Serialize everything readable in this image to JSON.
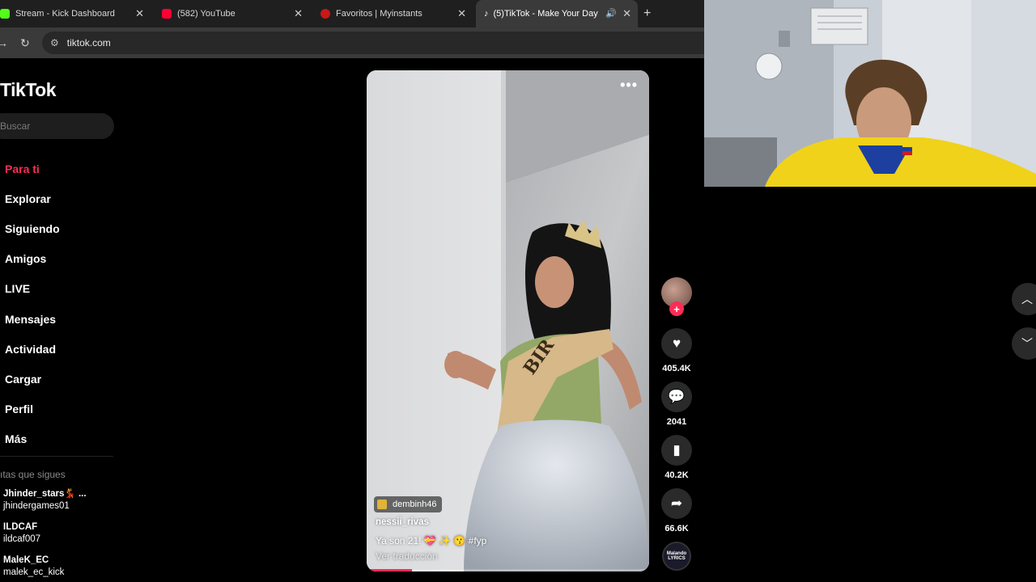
{
  "browser": {
    "tabs": [
      {
        "title": "Stream - Kick Dashboard",
        "favicon_color": "#53fc18"
      },
      {
        "title": "(582) YouTube",
        "favicon_color": "#ff0033"
      },
      {
        "title": "Favoritos | Myinstants",
        "favicon_color": "#c81818"
      },
      {
        "title": "(5)TikTok - Make Your Day",
        "favicon_color": "#000000"
      }
    ],
    "new_tab_glyph": "+",
    "url": "tiktok.com"
  },
  "tiktok": {
    "logo": "TikTok",
    "search_placeholder": "Buscar",
    "nav": [
      "Para ti",
      "Explorar",
      "Siguiendo",
      "Amigos",
      "LIVE",
      "Mensajes",
      "Actividad",
      "Cargar",
      "Perfil",
      "Más"
    ],
    "accent": "#fe2c55",
    "following_header": "ıtas que sigues",
    "following": [
      {
        "name": "Jhinder_stars💃 ...",
        "handle": "jhindergames01"
      },
      {
        "name": "ILDCAF",
        "handle": "ildcaf007"
      },
      {
        "name": "MaleK_EC",
        "handle": "malek_ec_kick"
      }
    ],
    "video": {
      "tag_user": "dembinh46",
      "author": "nessii_rivas",
      "caption": "Ya son 21! 💝 ✨ 😗 #fyp",
      "translate": "Ver traducción",
      "progress": 0.16,
      "sash_text": "BIR"
    },
    "actions": {
      "likes": "405.4K",
      "comments": "2041",
      "saves": "40.2K",
      "shares": "66.6K",
      "music_disc_text": "Malando LYRICS"
    }
  }
}
